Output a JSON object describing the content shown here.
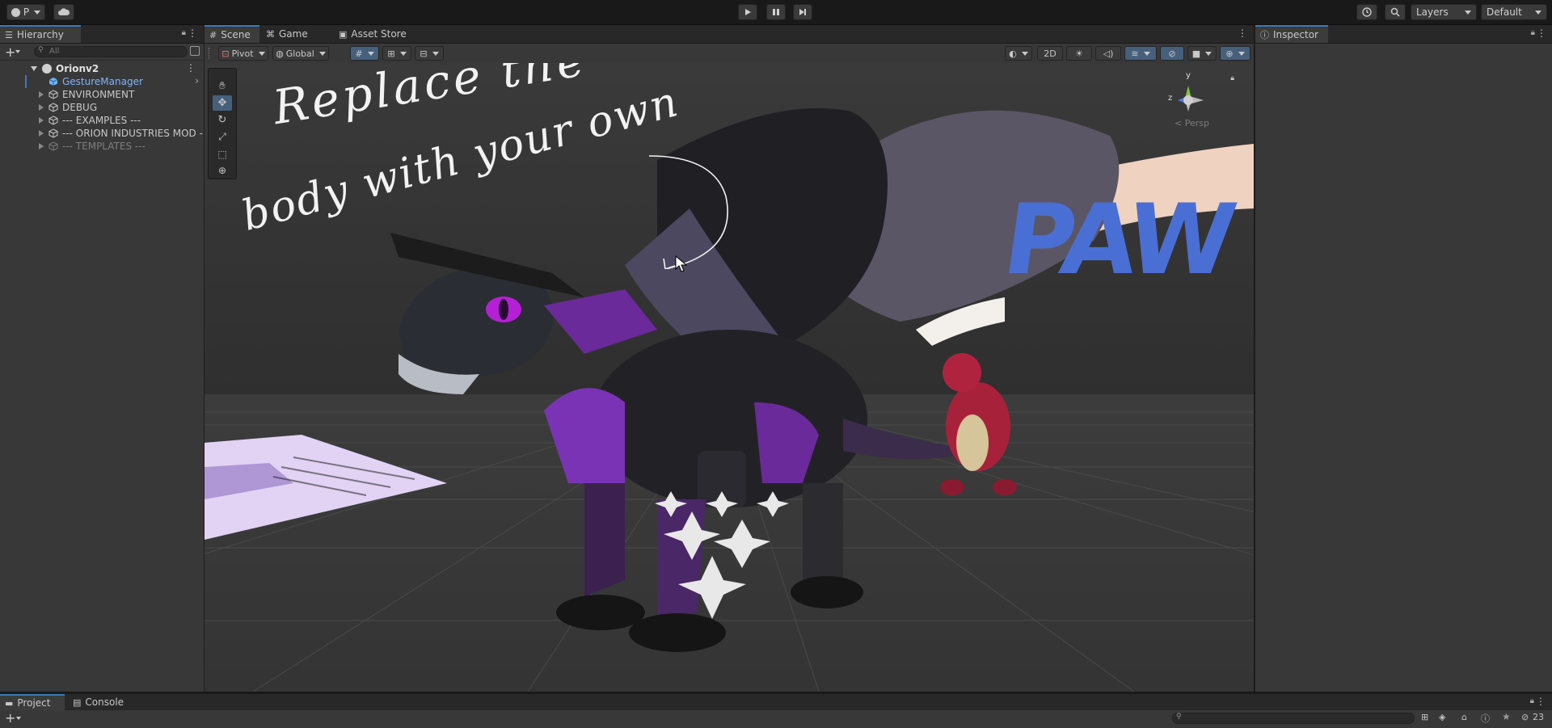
{
  "toolbar": {
    "account_label": "P",
    "layers_label": "Layers",
    "layout_label": "Default"
  },
  "hierarchy": {
    "tab_label": "Hierarchy",
    "search_placeholder": "All",
    "scene_name": "Orionv2",
    "items": [
      {
        "label": "GestureManager",
        "selected": true
      },
      {
        "label": "ENVIRONMENT"
      },
      {
        "label": "DEBUG"
      },
      {
        "label": "--- EXAMPLES ---"
      },
      {
        "label": "--- ORION INDUSTRIES MOD -"
      },
      {
        "label": "--- TEMPLATES ---",
        "dimmed": true
      }
    ]
  },
  "scene_view": {
    "tabs": [
      {
        "label": "Scene",
        "icon": "grid-icon",
        "active": true
      },
      {
        "label": "Game",
        "icon": "gamepad-icon"
      },
      {
        "label": "Asset Store",
        "icon": "store-bag-icon"
      }
    ],
    "pivot_label": "Pivot",
    "global_label": "Global",
    "mode_2d_label": "2D",
    "gizmo_labels": {
      "y": "y",
      "z": "z",
      "persp": "< Persp"
    },
    "annotation_line1": "Replace the",
    "annotation_line2": "body with your own",
    "sign_text": "PAW"
  },
  "inspector": {
    "tab_label": "Inspector"
  },
  "bottom": {
    "tabs": [
      {
        "label": "Project",
        "icon": "folder-icon"
      },
      {
        "label": "Console",
        "icon": "console-icon"
      }
    ],
    "hidden_count": "23"
  },
  "colors": {
    "accent": "#3a79bb",
    "selected_text": "#7cb6ff",
    "dragon_purple": "#8a2be2",
    "paw_blue": "#4a6fd4"
  }
}
